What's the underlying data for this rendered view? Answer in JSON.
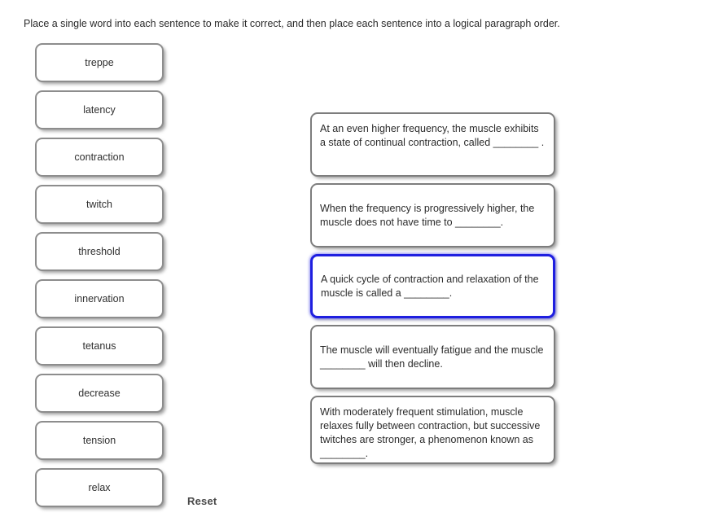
{
  "instruction": "Place a single word into each sentence to make it correct, and then place each sentence into a logical paragraph order.",
  "reset_label": "Reset",
  "colors": {
    "tile_border": "#8d8d8d",
    "box_border": "#7d7d7d",
    "selected_border": "#1f1fe0",
    "text": "#2b2b2b",
    "reset_text": "#4a4a4a",
    "background": "#ffffff"
  },
  "word_bank": {
    "items": [
      {
        "label": "treppe"
      },
      {
        "label": "latency"
      },
      {
        "label": "contraction"
      },
      {
        "label": "twitch"
      },
      {
        "label": "threshold"
      },
      {
        "label": "innervation"
      },
      {
        "label": "tetanus"
      },
      {
        "label": "decrease"
      },
      {
        "label": "tension"
      },
      {
        "label": "relax"
      }
    ]
  },
  "sentences": {
    "items": [
      {
        "text": "At an even higher frequency, the muscle exhibits a state of continual contraction, called ________ .",
        "selected": false,
        "align": "top"
      },
      {
        "text": "When the frequency is progressively higher, the muscle does not have time to ________.",
        "selected": false,
        "align": "center"
      },
      {
        "text": "A quick cycle of contraction and relaxation of the muscle is called a ________.",
        "selected": true,
        "align": "center"
      },
      {
        "text": "The muscle will eventually fatigue and the muscle ________ will then decline.",
        "selected": false,
        "align": "center"
      },
      {
        "text": "With moderately frequent stimulation, muscle relaxes fully between contraction, but successive twitches are stronger, a phenomenon known as ________.",
        "selected": false,
        "align": "top"
      }
    ]
  }
}
